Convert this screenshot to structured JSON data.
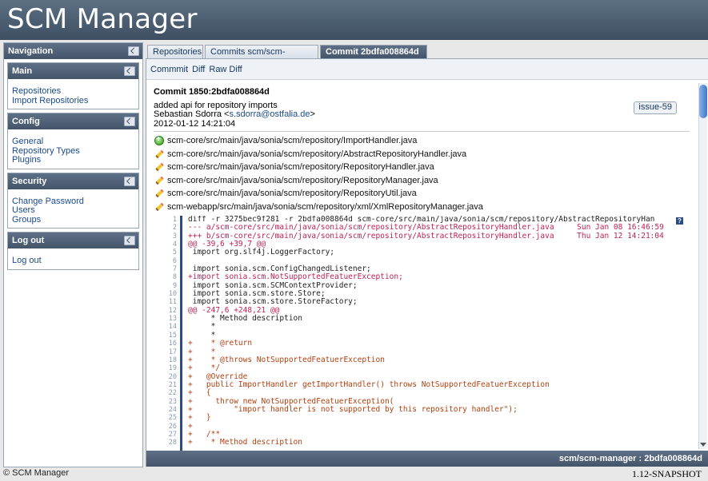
{
  "app": {
    "title": "SCM Manager"
  },
  "navigation": {
    "title": "Navigation",
    "sections": [
      {
        "title": "Main",
        "links": [
          "Repositories",
          "Import Repositories"
        ]
      },
      {
        "title": "Config",
        "links": [
          "General",
          "Repository Types",
          "Plugins"
        ]
      },
      {
        "title": "Security",
        "links": [
          "Change Password",
          "Users",
          "Groups"
        ]
      },
      {
        "title": "Log out",
        "links": [
          "Log out"
        ]
      }
    ]
  },
  "tabs": [
    {
      "label": "Repositories",
      "closable": false,
      "active": false
    },
    {
      "label": "Commits scm/scm-manager",
      "closable": true,
      "active": false
    },
    {
      "label": "Commit 2bdfa008864d",
      "closable": true,
      "active": true
    }
  ],
  "toolbar": {
    "commit": "Commmit",
    "diff": "Diff",
    "raw_diff": "Raw Diff"
  },
  "commit": {
    "title": "Commit 1850:2bdfa008864d",
    "message": "added api for repository imports",
    "author_name": "Sebastian Sdorra <",
    "author_email": "s.sdorra@ostfalia.de",
    "author_close": ">",
    "date": "2012-01-12 14:21:04",
    "tag": "issue-59"
  },
  "files": [
    {
      "status": "added",
      "path": "scm-core/src/main/java/sonia/scm/repository/ImportHandler.java"
    },
    {
      "status": "modified",
      "path": "scm-core/src/main/java/sonia/scm/repository/AbstractRepositoryHandler.java"
    },
    {
      "status": "modified",
      "path": "scm-core/src/main/java/sonia/scm/repository/RepositoryHandler.java"
    },
    {
      "status": "modified",
      "path": "scm-core/src/main/java/sonia/scm/repository/RepositoryManager.java"
    },
    {
      "status": "modified",
      "path": "scm-core/src/main/java/sonia/scm/repository/RepositoryUtil.java"
    },
    {
      "status": "modified",
      "path": "scm-webapp/src/main/java/sonia/scm/repository/xml/XmlRepositoryManager.java"
    }
  ],
  "diff": {
    "help": "?",
    "lines": [
      {
        "n": "1",
        "t": "meta",
        "text": "diff -r 3275bec9f281 -r 2bdfa008864d scm-core/src/main/java/sonia/scm/repository/AbstractRepositoryHan"
      },
      {
        "n": "2",
        "t": "del",
        "text": "--- a/scm-core/src/main/java/sonia/scm/repository/AbstractRepositoryHandler.java     Sun Jan 08 16:46:59"
      },
      {
        "n": "3",
        "t": "del",
        "text": "+++ b/scm-core/src/main/java/sonia/scm/repository/AbstractRepositoryHandler.java     Thu Jan 12 14:21:04"
      },
      {
        "n": "4",
        "t": "hunk",
        "text": "@@ -39,6 +39,7 @@"
      },
      {
        "n": "5",
        "t": "ctx",
        "text": " import org.slf4j.LoggerFactory;"
      },
      {
        "n": "6",
        "t": "ctx",
        "text": ""
      },
      {
        "n": "7",
        "t": "ctx",
        "text": " import sonia.scm.ConfigChangedListener;"
      },
      {
        "n": "8",
        "t": "del",
        "text": "+import sonia.scm.NotSupportedFeatuerException;"
      },
      {
        "n": "9",
        "t": "ctx",
        "text": " import sonia.scm.SCMContextProvider;"
      },
      {
        "n": "10",
        "t": "ctx",
        "text": " import sonia.scm.store.Store;"
      },
      {
        "n": "11",
        "t": "ctx",
        "text": " import sonia.scm.store.StoreFactory;"
      },
      {
        "n": "12",
        "t": "hunk",
        "text": "@@ -247,6 +248,21 @@"
      },
      {
        "n": "13",
        "t": "ctx",
        "text": "     * Method description"
      },
      {
        "n": "14",
        "t": "ctx",
        "text": "     *"
      },
      {
        "n": "15",
        "t": "ctx",
        "text": "     *"
      },
      {
        "n": "16",
        "t": "add",
        "text": "+    * @return"
      },
      {
        "n": "17",
        "t": "add",
        "text": "+    *"
      },
      {
        "n": "18",
        "t": "add",
        "text": "+    * @throws NotSupportedFeatuerException"
      },
      {
        "n": "19",
        "t": "add",
        "text": "+    */"
      },
      {
        "n": "20",
        "t": "add",
        "text": "+   @Override"
      },
      {
        "n": "21",
        "t": "add",
        "text": "+   public ImportHandler getImportHandler() throws NotSupportedFeatuerException"
      },
      {
        "n": "22",
        "t": "add",
        "text": "+   {"
      },
      {
        "n": "23",
        "t": "add",
        "text": "+     throw new NotSupportedFeatuerException("
      },
      {
        "n": "24",
        "t": "add",
        "text": "+         \"import handler is not supported by this repository handler\");"
      },
      {
        "n": "25",
        "t": "add",
        "text": "+   }"
      },
      {
        "n": "26",
        "t": "add",
        "text": "+"
      },
      {
        "n": "27",
        "t": "add",
        "text": "+   /**"
      },
      {
        "n": "28",
        "t": "add",
        "text": "+    * Method description"
      }
    ]
  },
  "status_bar": "scm/scm-manager : 2bdfa008864d",
  "footer": {
    "copyright": "© SCM Manager",
    "version": "1.12-SNAPSHOT"
  }
}
